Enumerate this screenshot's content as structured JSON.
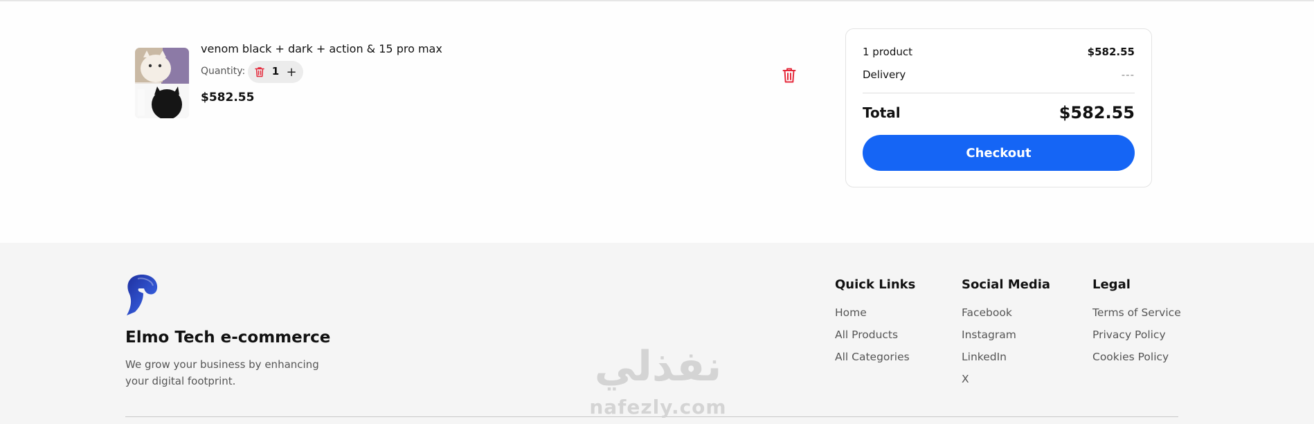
{
  "cart": {
    "item": {
      "name": "venom black + dark + action & 15 pro max",
      "quantity_label": "Quantity:",
      "quantity": "1",
      "plus_symbol": "+",
      "price": "$582.55"
    }
  },
  "summary": {
    "product_count": "1 product",
    "subtotal": "$582.55",
    "delivery_label": "Delivery",
    "delivery_value": "---",
    "total_label": "Total",
    "total_value": "$582.55",
    "checkout_label": "Checkout"
  },
  "footer": {
    "brand": "Elmo Tech e-commerce",
    "tagline": "We grow your business by enhancing your digital footprint.",
    "quick_links": {
      "title": "Quick Links",
      "items": [
        "Home",
        "All Products",
        "All Categories"
      ]
    },
    "social_media": {
      "title": "Social Media",
      "items": [
        "Facebook",
        "Instagram",
        "LinkedIn",
        "X"
      ]
    },
    "legal": {
      "title": "Legal",
      "items": [
        "Terms of Service",
        "Privacy Policy",
        "Cookies Policy"
      ]
    }
  },
  "watermark": {
    "arabic": "نفذلي",
    "latin": "nafezly.com"
  },
  "icons": {
    "remove": "trash-icon",
    "decrement": "trash-icon",
    "increment": "plus-icon",
    "logo": "spartan-helmet-logo"
  },
  "colors": {
    "accent": "#1565f5",
    "danger": "#e5283a",
    "brand_logo": "#2540c8"
  }
}
